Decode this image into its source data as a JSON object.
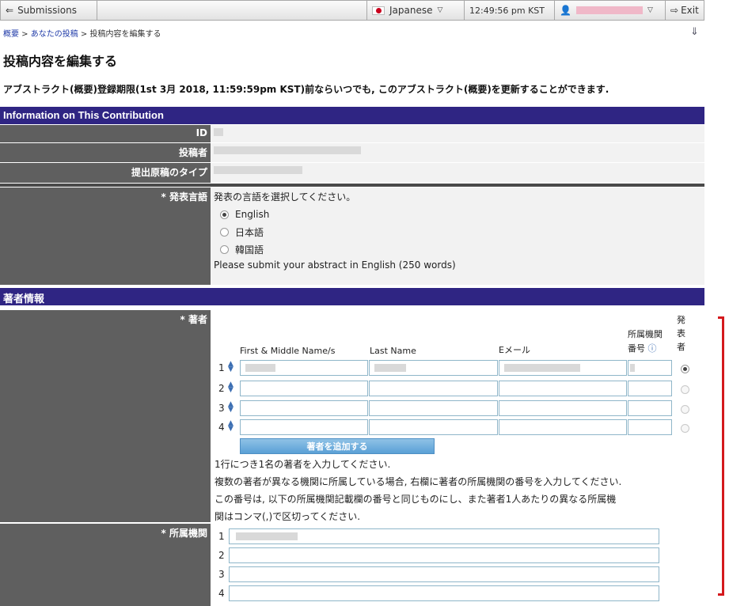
{
  "topbar": {
    "back_label": "Submissions",
    "language": "Japanese",
    "time": "12:49:56 pm KST",
    "exit_label": "Exit"
  },
  "breadcrumb": {
    "items": [
      "概要",
      "あなたの投稿",
      "投稿内容を編集する"
    ],
    "sep": " > "
  },
  "page_title": "投稿内容を編集する",
  "deadline_text": "アブストラクト(概要)登録期限(1st 3月 2018, 11:59:59pm KST)前ならいつでも, このアブストラクト(概要)を更新することができます.",
  "info_section": {
    "title": "Information on This Contribution",
    "rows": [
      {
        "label": "ID"
      },
      {
        "label": "投稿者"
      },
      {
        "label": "提出原稿のタイプ"
      }
    ]
  },
  "language_field": {
    "label": "* 発表言語",
    "prompt": "発表の言語を選択してください。",
    "options": [
      "English",
      "日本語",
      "韓国語"
    ],
    "selected": "English",
    "note": "Please submit your abstract in English (250 words)"
  },
  "author_section": {
    "title": "著者情報",
    "authors_label": "* 著者",
    "columns": {
      "first": "First & Middle Name/s",
      "last": "Last Name",
      "email": "Eメール",
      "affil": "所属機関番号",
      "presenter": "発表者"
    },
    "row_numbers": [
      "1",
      "2",
      "3",
      "4"
    ],
    "add_button": "著者を追加する",
    "notes": [
      "1行につき1名の著者を入力してください.",
      "複数の著者が異なる機関に所属している場合, 右欄に著者の所属機関の番号を入力してください.",
      "この番号は, 以下の所属機関記載欄の番号と同じものにし、また著者1人あたりの異なる所属機",
      "関はコンマ(,)で区切ってください."
    ],
    "affiliation_label": "* 所属機関",
    "affiliation_numbers": [
      "1",
      "2",
      "3",
      "4"
    ]
  }
}
